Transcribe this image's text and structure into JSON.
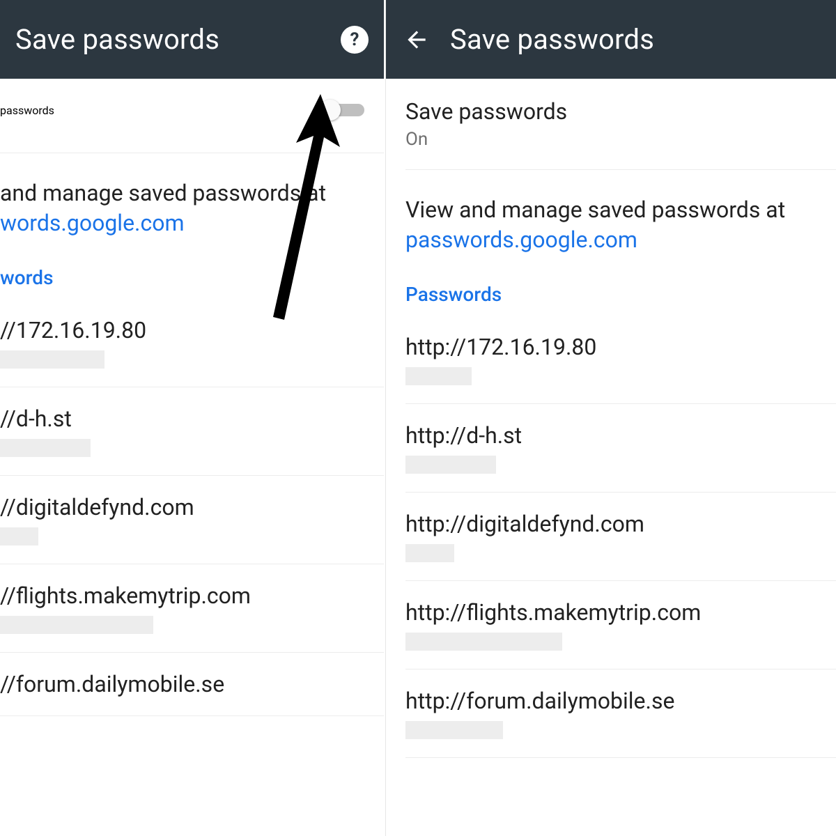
{
  "left": {
    "appbar_title": "Save passwords",
    "toggle_label": "passwords",
    "info_prefix": " and manage saved passwords at ",
    "info_link": "words.google.com",
    "section_label": "words",
    "sites": [
      "//172.16.19.80",
      "//d-h.st",
      "//digitaldefynd.com",
      "//flights.makemytrip.com",
      "//forum.dailymobile.se"
    ],
    "blur_widths": [
      150,
      130,
      55,
      220,
      0
    ]
  },
  "right": {
    "appbar_title": "Save passwords",
    "toggle_label": "Save passwords",
    "toggle_status": "On",
    "info_prefix": "View and manage saved passwords at ",
    "info_link": "passwords.google.com",
    "section_label": "Passwords",
    "sites": [
      "http://172.16.19.80",
      "http://d-h.st",
      "http://digitaldefynd.com",
      "http://flights.makemytrip.com",
      "http://forum.dailymobile.se"
    ],
    "blur_widths": [
      95,
      130,
      70,
      225,
      140
    ]
  },
  "colors": {
    "link": "#1a73e8"
  }
}
